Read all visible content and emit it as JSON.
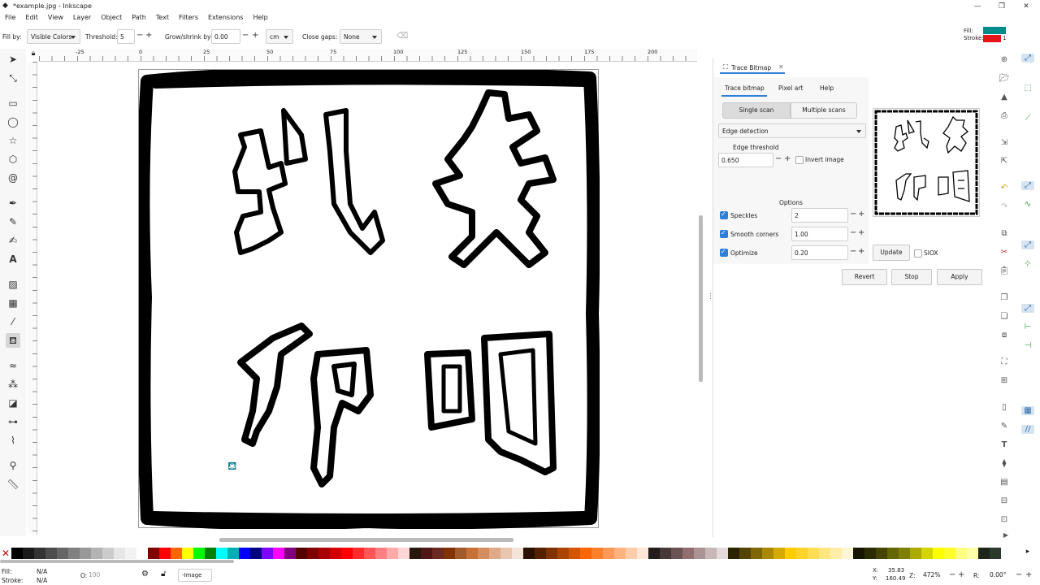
{
  "window": {
    "title": "*example.jpg - Inkscape",
    "min": "—",
    "max": "❐",
    "close": "✕"
  },
  "menu": [
    "File",
    "Edit",
    "View",
    "Layer",
    "Object",
    "Path",
    "Text",
    "Filters",
    "Extensions",
    "Help"
  ],
  "toolctrl": {
    "fill_by_label": "Fill by:",
    "fill_by_value": "Visible Colors",
    "threshold_label": "Threshold:",
    "threshold_value": "5",
    "grow_label": "Grow/shrink by:",
    "grow_value": "0.00",
    "unit_value": "cm",
    "close_gaps_label": "Close gaps:",
    "close_gaps_value": "None"
  },
  "fill_stroke": {
    "fill_label": "Fill:",
    "stroke_label": "Stroke:",
    "stroke_width": "1",
    "fill_color": "#008b8b",
    "stroke_color": "#e8141b"
  },
  "ruler_h": [
    "-25",
    "0",
    "25",
    "50",
    "75",
    "100",
    "125",
    "150",
    "175",
    "200"
  ],
  "dock": {
    "tab_title": "Trace Bitmap",
    "tabs": [
      "Trace bitmap",
      "Pixel art",
      "Help"
    ],
    "modes": [
      "Single scan",
      "Multiple scans"
    ],
    "method": "Edge detection",
    "edge_threshold_label": "Edge threshold",
    "edge_threshold_value": "0.650",
    "invert_label": "Invert image",
    "options_label": "Options",
    "speckles_label": "Speckles",
    "speckles_value": "2",
    "smooth_label": "Smooth corners",
    "smooth_value": "1.00",
    "optimize_label": "Optimize",
    "optimize_value": "0.20",
    "update_label": "Update",
    "siox_label": "SIOX",
    "revert_label": "Revert",
    "stop_label": "Stop",
    "apply_label": "Apply"
  },
  "status": {
    "fill_label": "Fill:",
    "fill_value": "N/A",
    "stroke_label": "Stroke:",
    "stroke_value": "N/A",
    "opacity_label": "O:",
    "opacity_value": "100",
    "layer_value": "-Image",
    "x_label": "X:",
    "x_value": "35.83",
    "y_label": "Y:",
    "y_value": "160.49",
    "zoom_label": "Z:",
    "zoom_value": "472%",
    "rot_label": "R:",
    "rot_value": "0.00°"
  },
  "palette": [
    "#000000",
    "#1a1a1a",
    "#333333",
    "#4d4d4d",
    "#666666",
    "#808080",
    "#999999",
    "#b3b3b3",
    "#cccccc",
    "#e6e6e6",
    "#f2f2f2",
    "#ffffff",
    "#800000",
    "#ff0000",
    "#ff6600",
    "#ffff00",
    "#00ff00",
    "#008000",
    "#00ffff",
    "#00b0b0",
    "#0000ff",
    "#000080",
    "#8000ff",
    "#ff00ff",
    "#800080",
    "#550000",
    "#800000",
    "#aa0000",
    "#d40000",
    "#ff0000",
    "#ff2a2a",
    "#ff5555",
    "#ff8080",
    "#ffaaaa",
    "#ffd5d5",
    "#28170b",
    "#501616",
    "#6c2a22",
    "#803300",
    "#a05a2c",
    "#c87137",
    "#d38d5f",
    "#deaa87",
    "#e9c6af",
    "#f4e3d7",
    "#2b1100",
    "#552200",
    "#803300",
    "#aa4400",
    "#d45500",
    "#ff6600",
    "#ff7f2a",
    "#ff9955",
    "#ffb380",
    "#ffccaa",
    "#ffe6d5",
    "#241c1c",
    "#483737",
    "#6c5353",
    "#916f6f",
    "#ac9393",
    "#c8b7b7",
    "#e3dbdb",
    "#2b2200",
    "#554400",
    "#806600",
    "#aa8800",
    "#d4aa00",
    "#ffcc00",
    "#ffd42a",
    "#ffdd55",
    "#ffe680",
    "#ffeeaa",
    "#fff6d5",
    "#161600",
    "#2b2b00",
    "#444400",
    "#666600",
    "#808000",
    "#aaaa00",
    "#d4d400",
    "#ffff00",
    "#ffff2a",
    "#ffff80",
    "#ffffaa",
    "#1c241c",
    "#2b3b2b"
  ]
}
